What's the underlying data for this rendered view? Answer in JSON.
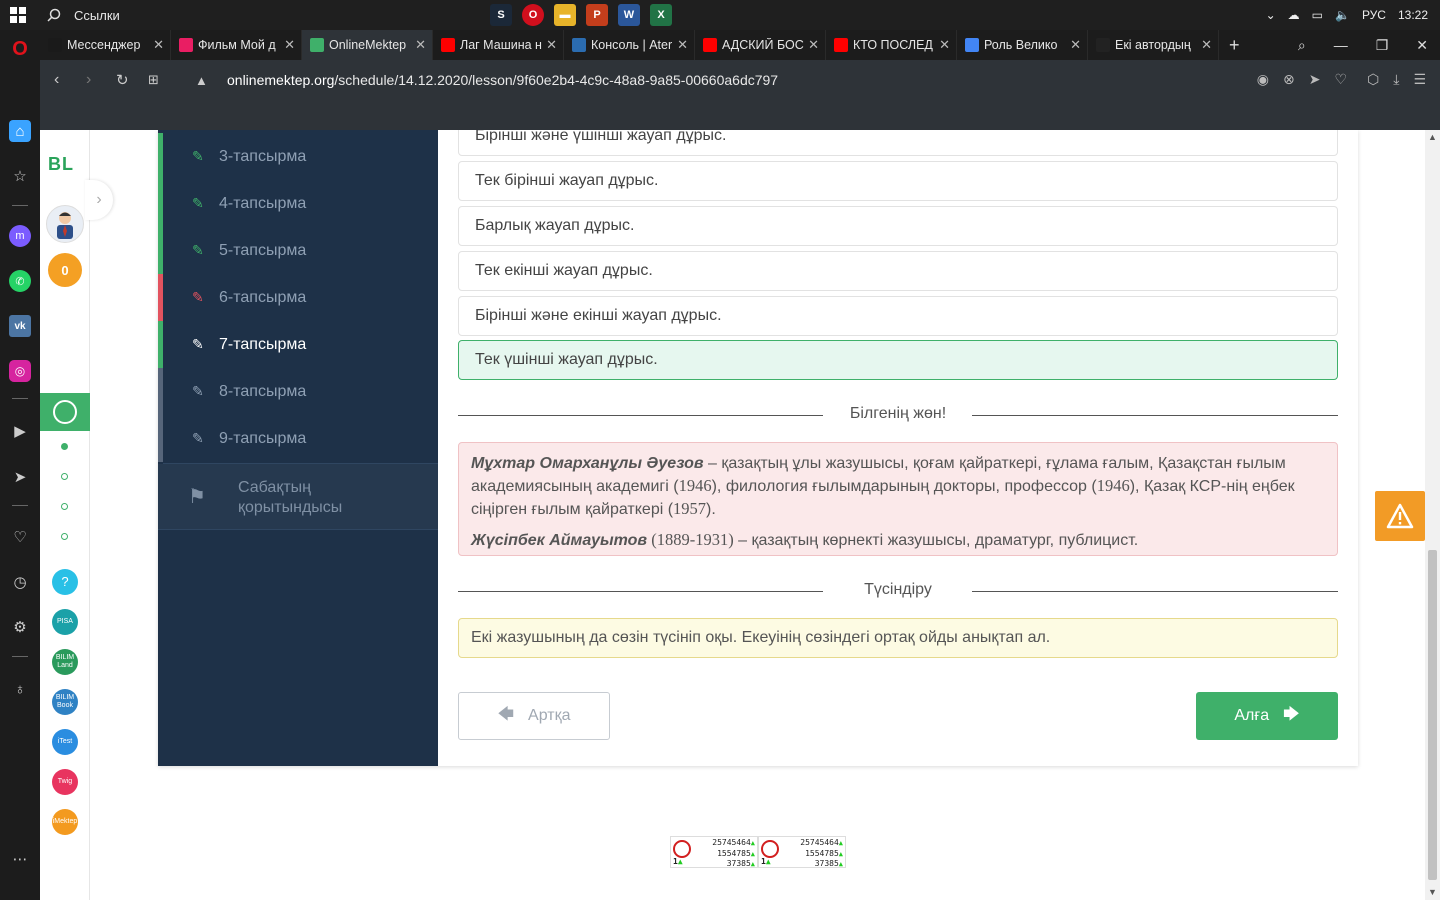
{
  "taskbar": {
    "links_label": "Ссылки",
    "lang": "РУС",
    "time": "13:22"
  },
  "browser": {
    "tabs": [
      {
        "label": "Мессенджер",
        "icon": "messenger-icon",
        "color": "#1a1a1a"
      },
      {
        "label": "Фильм Мой д",
        "icon": "ivi-icon",
        "color": "#e91e63"
      },
      {
        "label": "OnlineMektep",
        "icon": "onlinemektep-icon",
        "color": "#3fb06a",
        "active": true
      },
      {
        "label": "Лаг Машина н",
        "icon": "youtube-icon",
        "color": "#ff0000"
      },
      {
        "label": "Консоль | Ater",
        "icon": "aternos-icon",
        "color": "#2b6cb0"
      },
      {
        "label": "АДСКИЙ БОС",
        "icon": "youtube-icon",
        "color": "#ff0000"
      },
      {
        "label": "КТО ПОСЛЕД",
        "icon": "youtube-icon",
        "color": "#ff0000"
      },
      {
        "label": "Роль Велико",
        "icon": "google-icon",
        "color": "#4285f4"
      },
      {
        "label": "Екі автордың",
        "icon": "z-icon",
        "color": "#222"
      }
    ],
    "url_domain": "onlinemektep.org",
    "url_path": "/schedule/14.12.2020/lesson/9f60e2b4-4c9c-48a8-9a85-00660a6dc797"
  },
  "rail": {
    "logo": "BL",
    "coins": "0"
  },
  "menu": {
    "items": [
      {
        "label": "3-тапсырма",
        "status": "green"
      },
      {
        "label": "4-тапсырма",
        "status": "green"
      },
      {
        "label": "5-тапсырма",
        "status": "green"
      },
      {
        "label": "6-тапсырма",
        "status": "red"
      },
      {
        "label": "7-тапсырма",
        "status": "green",
        "active": true
      },
      {
        "label": "8-тапсырма",
        "status": "grey"
      },
      {
        "label": "9-тапсырма",
        "status": "grey"
      }
    ],
    "final_label": "Сабақтың қорытындысы"
  },
  "answers": [
    {
      "text": "Бірінші және үшінші жауап дұрыс."
    },
    {
      "text": "Тек бірінші жауап дұрыс."
    },
    {
      "text": "Барлық жауап дұрыс."
    },
    {
      "text": "Тек екінші жауап дұрыс."
    },
    {
      "text": "Бірінші және екінші жауап дұрыс."
    },
    {
      "text": "Тек үшінші жауап дұрыс.",
      "correct": true
    }
  ],
  "knowledge": {
    "heading": "Білгенің жөн!",
    "p1_name": "Мұхтар Омарханұлы Әуезов",
    "p1_a": " – қазақтың ұлы жазушысы, қоғам қайраткері, ғұлама ғалым, Қазақстан ғылым академиясының академигі (",
    "p1_y1": "1946",
    "p1_b": "), филология ғылымдарының докторы, профессор (",
    "p1_y2": "1946",
    "p1_c": "), Қазақ КСР-нің еңбек сіңірген ғылым қайраткері (",
    "p1_y3": "1957",
    "p1_d": ").",
    "p2_name": "Жүсіпбек Аймауытов",
    "p2_years": " (1889-1931)",
    "p2_rest": " – қазақтың көрнекті жазушысы, драматург, публицист."
  },
  "explain": {
    "heading": "Түсіндіру",
    "text": "Екі жазушының да сөзін түсініп оқы. Екеуінің сөзіндегі ортақ ойды анықтап ал."
  },
  "nav": {
    "back": "Артқа",
    "next": "Алға"
  },
  "counters": [
    {
      "one": "1",
      "n1": "25745464",
      "n2": "1554785",
      "n3": "37385"
    },
    {
      "one": "1",
      "n1": "25745464",
      "n2": "1554785",
      "n3": "37385"
    }
  ]
}
